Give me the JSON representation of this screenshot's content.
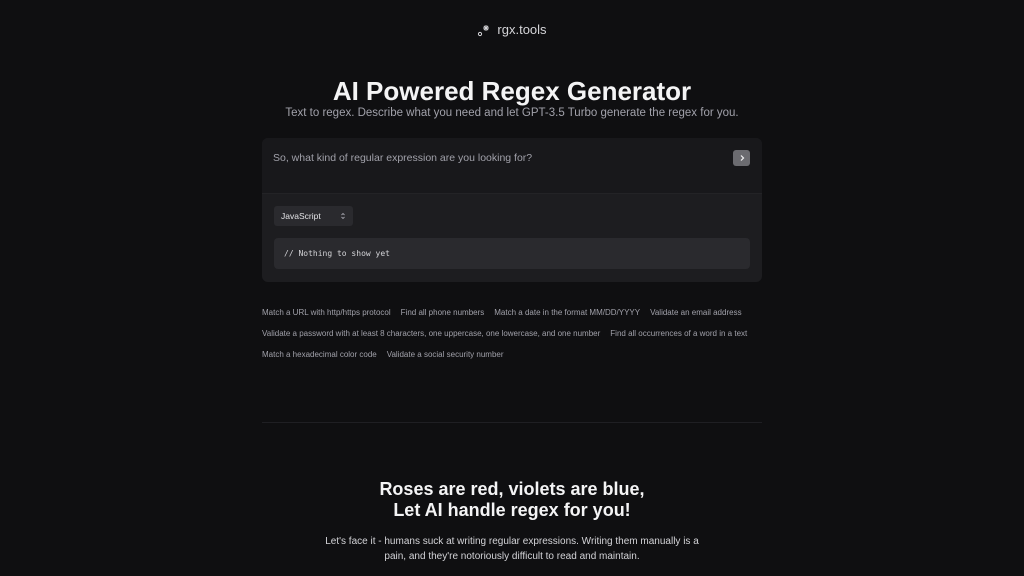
{
  "header": {
    "brand_name": "rgx.tools",
    "brand_icon": "sparkle-dots-icon"
  },
  "hero": {
    "title": "AI Powered Regex Generator",
    "subtitle": "Text to regex. Describe what you need and let GPT-3.5 Turbo generate the regex for you."
  },
  "generator": {
    "prompt_placeholder": "So, what kind of regular expression are you looking for?",
    "prompt_value": "",
    "submit_icon": "chevron-right-icon",
    "language_selected": "JavaScript",
    "language_icon": "chevron-up-down-icon",
    "output_text": "// Nothing to show yet"
  },
  "examples": [
    "Match a URL with http/https protocol",
    "Find all phone numbers",
    "Match a date in the format MM/DD/YYYY",
    "Validate an email address",
    "Validate a password with at least 8 characters, one uppercase, one lowercase, and one number",
    "Find all occurrences of a word in a text",
    "Match a hexadecimal color code",
    "Validate a social security number"
  ],
  "tagline": {
    "line1": "Roses are red, violets are blue,",
    "line2": "Let AI handle regex for you!"
  },
  "intro": {
    "text": "Let's face it - humans suck at writing regular expressions. Writing them manually is a pain, and they're notoriously difficult to read and maintain."
  },
  "colors": {
    "background": "#0f0f11",
    "card": "#1d1d20",
    "muted_text": "#a1a1aa",
    "button": "#6b6b70"
  }
}
